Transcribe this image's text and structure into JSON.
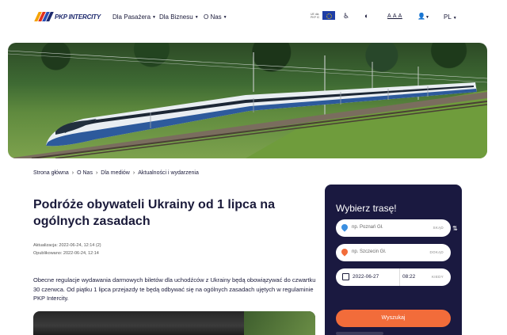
{
  "header": {
    "logo_text": "PKP INTERCITY",
    "nav": [
      {
        "label": "Dla Pasażera"
      },
      {
        "label": "Dla Biznesu"
      },
      {
        "label": "O Nas"
      }
    ],
    "eu_text": "UE dla PKP IC",
    "accessibility_icon": "wheelchair-icon",
    "contrast_icon": "contrast-icon",
    "font_size_label": "A A A",
    "user_icon": "user-icon",
    "language": "PL"
  },
  "breadcrumb": [
    "Strona główna",
    "O Nas",
    "Dla mediów",
    "Aktualności i wydarzenia"
  ],
  "article": {
    "title": "Podróże obywateli Ukrainy od 1 lipca na ogólnych zasadach",
    "updated": "Aktualizacja: 2022-06-24, 12:14 (2)",
    "published": "Opublikowano: 2022-06-24, 12:14",
    "lead": "Obecne regulacje wydawania darmowych biletów dla uchodźców z Ukrainy będą obowiązywać do czwartku 30 czerwca. Od piątku 1 lipca przejazdy te będą odbywać się na ogólnych zasadach ujętych w regulaminie PKP Intercity."
  },
  "route_panel": {
    "title": "Wybierz trasę!",
    "from_placeholder": "np. Poznań Gł.",
    "from_tag": "SKĄD",
    "to_placeholder": "np. Szczecin Gł.",
    "to_tag": "DOKĄD",
    "date": "2022-06-27",
    "time": "08:22",
    "when_tag": "KIEDY",
    "search_button": "Wyszukaj"
  },
  "colors": {
    "navy": "#1a1940",
    "accent_orange": "#f26c3a",
    "text": "#1a1a3a"
  }
}
